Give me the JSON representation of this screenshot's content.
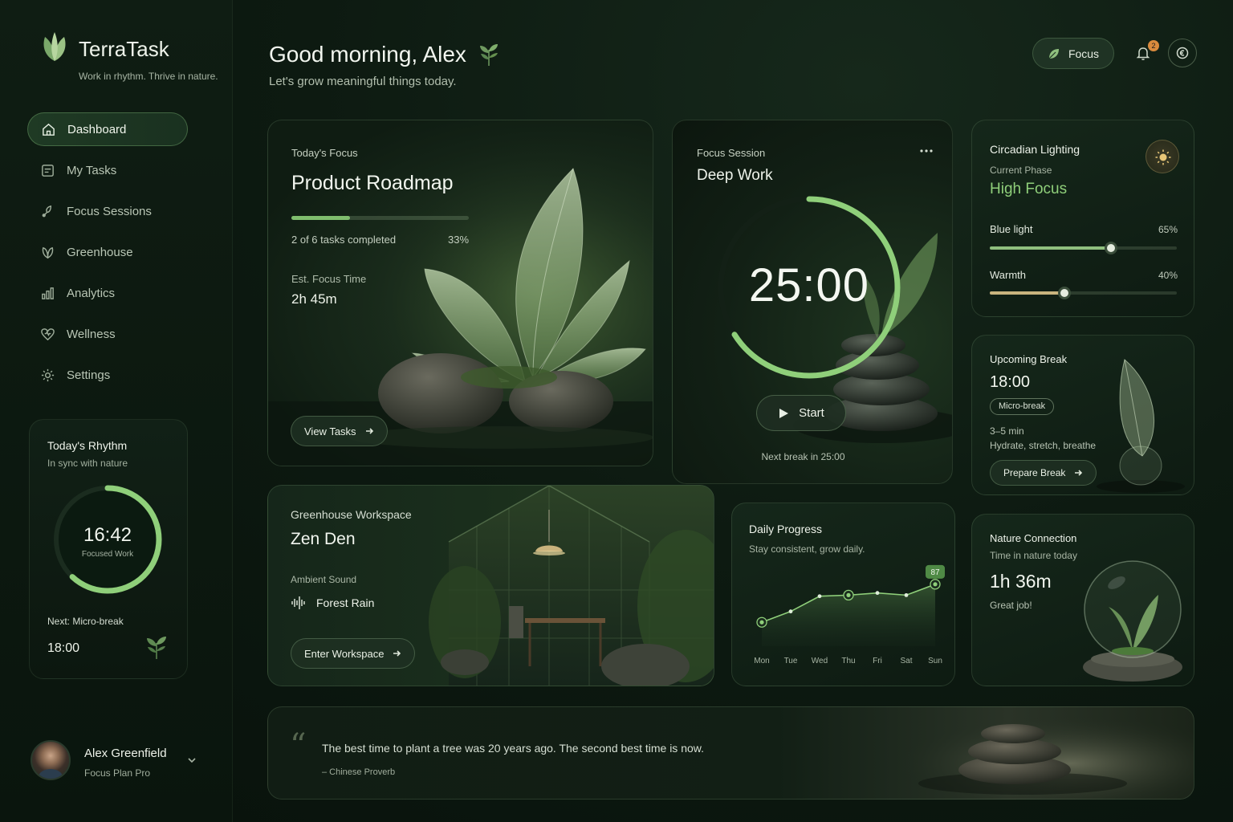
{
  "brand": {
    "name": "TerraTask",
    "tagline": "Work in rhythm. Thrive in nature."
  },
  "nav": [
    {
      "label": "Dashboard",
      "icon": "home-icon",
      "active": true
    },
    {
      "label": "My Tasks",
      "icon": "task-list-icon"
    },
    {
      "label": "Focus Sessions",
      "icon": "focus-icon"
    },
    {
      "label": "Greenhouse",
      "icon": "leaf-icon"
    },
    {
      "label": "Analytics",
      "icon": "bar-chart-icon"
    },
    {
      "label": "Wellness",
      "icon": "heart-icon"
    },
    {
      "label": "Settings",
      "icon": "gear-icon"
    }
  ],
  "rhythm": {
    "title": "Today's Rhythm",
    "subtitle": "In sync with nature",
    "time": "16:42",
    "label": "Focused Work",
    "progress": 0.62,
    "next_label": "Next: Micro-break",
    "next_time": "18:00"
  },
  "user": {
    "name": "Alex Greenfield",
    "plan": "Focus Plan Pro"
  },
  "header": {
    "greeting": "Good morning, Alex",
    "subtitle": "Let's grow meaningful things today.",
    "focus_button": "Focus",
    "notifications_count": "2"
  },
  "focus_card": {
    "label": "Today's Focus",
    "title": "Product Roadmap",
    "progress": 0.33,
    "progress_text": "2 of 6 tasks completed",
    "progress_pct": "33%",
    "est_label": "Est. Focus Time",
    "est_value": "2h 45m",
    "button": "View Tasks"
  },
  "session_card": {
    "label": "Focus Session",
    "title": "Deep Work",
    "timer": "25:00",
    "progress": 0.66,
    "start_label": "Start",
    "next_break": "Next break in 25:00"
  },
  "circadian": {
    "title": "Circadian Lighting",
    "phase_label": "Current Phase",
    "phase": "High Focus",
    "sliders": [
      {
        "label": "Blue light",
        "value": 65,
        "display": "65%",
        "color": "#8fbf7e"
      },
      {
        "label": "Warmth",
        "value": 40,
        "display": "40%",
        "color": "#c9b47e"
      }
    ]
  },
  "upcoming_break": {
    "title": "Upcoming Break",
    "time": "18:00",
    "tag": "Micro-break",
    "duration": "3–5 min",
    "description": "Hydrate, stretch, breathe",
    "button": "Prepare Break"
  },
  "greenhouse": {
    "label": "Greenhouse Workspace",
    "title": "Zen Den",
    "ambient_label": "Ambient Sound",
    "ambient_value": "Forest Rain",
    "button": "Enter Workspace"
  },
  "daily_progress": {
    "title": "Daily Progress",
    "subtitle": "Stay consistent, grow daily."
  },
  "chart_data": {
    "type": "area",
    "categories": [
      "Mon",
      "Tue",
      "Wed",
      "Thu",
      "Fri",
      "Sat",
      "Sun"
    ],
    "values": [
      52,
      62,
      76,
      77,
      79,
      77,
      87
    ],
    "highlighted": [
      0,
      3,
      6
    ],
    "end_label": "87",
    "ylim": [
      30,
      95
    ],
    "grid": false,
    "color": "#8fcf7a"
  },
  "nature": {
    "title": "Nature Connection",
    "subtitle": "Time in nature today",
    "value": "1h 36m",
    "note": "Great job!"
  },
  "quote": {
    "text": "The best time to plant a tree was 20 years ago. The second best time is now.",
    "author": "– Chinese Proverb"
  },
  "colors": {
    "accent": "#8fcf7a",
    "background": "#0d1a11",
    "badge": "#d98a3d"
  }
}
